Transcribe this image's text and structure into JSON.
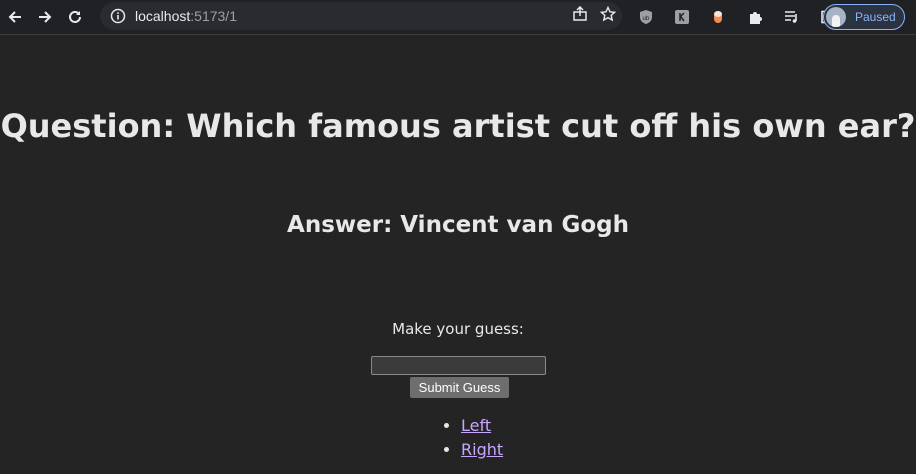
{
  "browser": {
    "url_host": "localhost",
    "url_port": ":5173/1",
    "profile_status": "Paused",
    "icons": [
      "back-arrow-icon",
      "forward-arrow-icon",
      "reload-icon",
      "info-icon",
      "share-icon",
      "star-icon",
      "ublock-icon",
      "extension-icon",
      "extension-icon",
      "puzzle-icon",
      "media-queue-icon",
      "sidebar-icon"
    ]
  },
  "page": {
    "question": "Question: Which famous artist cut off his own ear?",
    "answer": "Answer: Vincent van Gogh",
    "guess_label": "Make your guess:",
    "guess_value": "",
    "submit_label": "Submit Guess",
    "links": [
      {
        "label": "Left"
      },
      {
        "label": "Right"
      }
    ]
  },
  "colors": {
    "background": "#242424",
    "text": "#e8e8e8",
    "link": "#c9a6ff",
    "button": "#6e6e6e"
  }
}
